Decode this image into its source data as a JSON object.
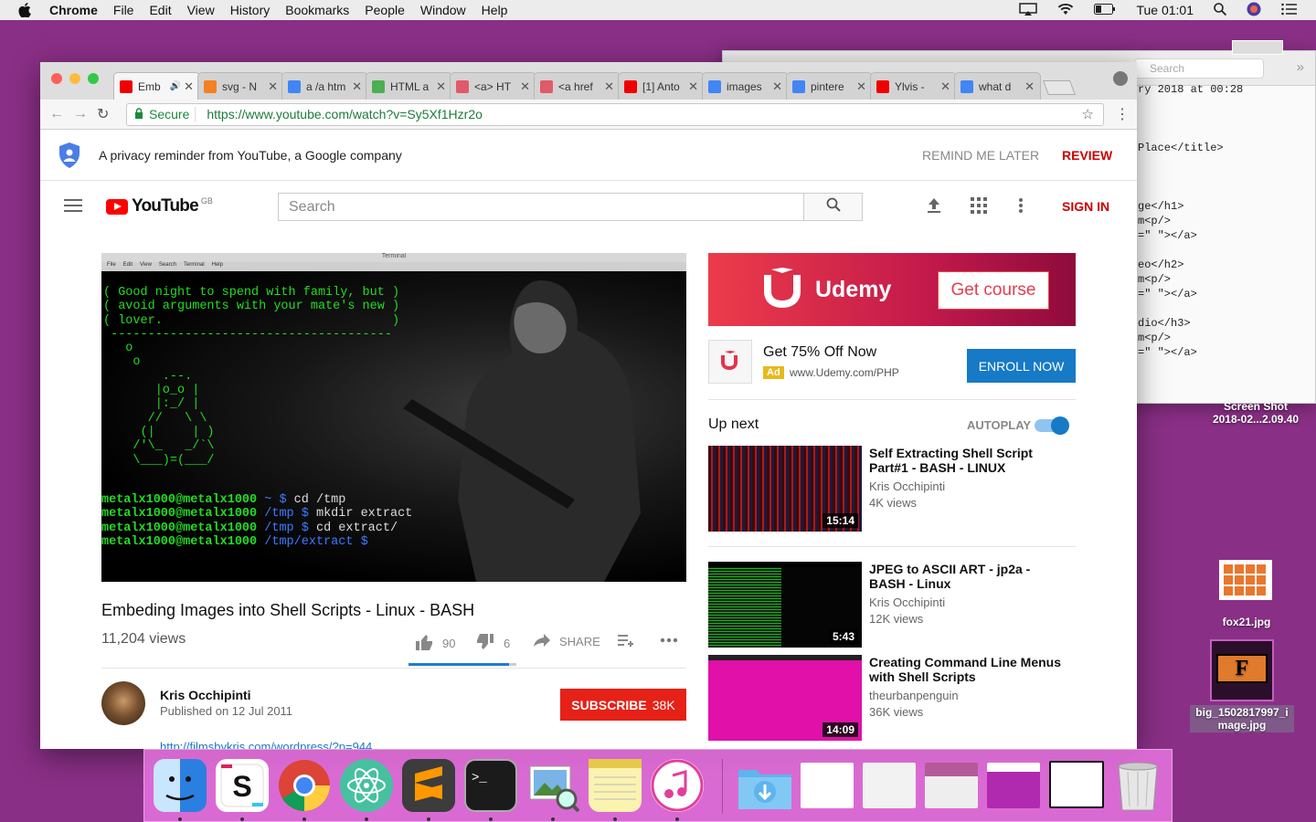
{
  "menubar": {
    "app": "Chrome",
    "items": [
      "File",
      "Edit",
      "View",
      "History",
      "Bookmarks",
      "People",
      "Window",
      "Help"
    ],
    "clock": "Tue 01:01"
  },
  "bg_window": {
    "search_placeholder": "Search",
    "lines": [
      "ry 2018 at 00:28",
      "",
      "",
      "",
      "Place</title>",
      "",
      "",
      "",
      "ge</h1>",
      "m<p/>",
      "=\" \"></a>",
      "",
      "eo</h2>",
      "m<p/>",
      "=\" \"></a>",
      "",
      "dio</h3>",
      "m<p/>",
      "=\" \"></a>"
    ]
  },
  "desktop": {
    "screenshot_label": "Screen Shot",
    "screenshot_date": "2018-02...2.09.40",
    "fox_label": "fox21.jpg",
    "big_label_1": "big_1502817997_i",
    "big_label_2": "mage.jpg"
  },
  "browser": {
    "tabs": [
      {
        "title": "Emb",
        "icon": "youtube-icon",
        "color": "#e00"
      },
      {
        "title": "svg - N",
        "icon": "stackoverflow-icon",
        "color": "#f48024"
      },
      {
        "title": "a /a htm",
        "icon": "google-icon",
        "color": "#4285f4"
      },
      {
        "title": "HTML a",
        "icon": "w3-icon",
        "color": "#4caf50"
      },
      {
        "title": "<a> HT",
        "icon": "h-icon",
        "color": "#e05a6a"
      },
      {
        "title": "<a href",
        "icon": "h-icon",
        "color": "#e05a6a"
      },
      {
        "title": "[1] Anto",
        "icon": "youtube-icon",
        "color": "#e00"
      },
      {
        "title": "images",
        "icon": "google-icon",
        "color": "#4285f4"
      },
      {
        "title": "pintere",
        "icon": "google-icon",
        "color": "#4285f4"
      },
      {
        "title": "Ylvis -",
        "icon": "youtube-icon",
        "color": "#e00"
      },
      {
        "title": "what d",
        "icon": "google-icon",
        "color": "#4285f4"
      }
    ],
    "secure": "Secure",
    "url": "https://www.youtube.com/watch?v=Sy5Xf1Hzr2o"
  },
  "privacy": {
    "text": "A privacy reminder from YouTube, a Google company",
    "remind": "REMIND ME LATER",
    "review": "REVIEW"
  },
  "youtube": {
    "logo": "YouTube",
    "region": "GB",
    "search_placeholder": "Search",
    "sign_in": "SIGN IN"
  },
  "video": {
    "term_title": "Terminal",
    "term_menu": [
      "File",
      "Edit",
      "View",
      "Search",
      "Terminal",
      "Help"
    ],
    "title": "Embeding Images into Shell Scripts - Linux - BASH",
    "views": "11,204 views",
    "likes": "90",
    "dislikes": "6",
    "share": "SHARE",
    "channel": "Kris Occhipinti",
    "published": "Published on 12 Jul 2011",
    "subscribe": "SUBSCRIBE",
    "subs": "38K",
    "link": "http://filmsbykris.com/wordpress/?p=944"
  },
  "ad": {
    "brand": "Udemy",
    "cta": "Get course",
    "headline": "Get 75% Off Now",
    "badge": "Ad",
    "url": "www.Udemy.com/PHP",
    "enroll": "ENROLL NOW"
  },
  "upnext": {
    "label": "Up next",
    "autoplay": "AUTOPLAY",
    "autoplay_on": true,
    "items": [
      {
        "title": "Self Extracting Shell Script Part#1 - BASH - LINUX",
        "channel": "Kris Occhipinti",
        "views": "4K views",
        "duration": "15:14"
      },
      {
        "title": "JPEG to ASCII ART - jp2a - BASH - Linux",
        "channel": "Kris Occhipinti",
        "views": "12K views",
        "duration": "5:43"
      },
      {
        "title": "Creating Command Line Menus with Shell Scripts",
        "channel": "theurbanpenguin",
        "views": "36K views",
        "duration": "14:09"
      }
    ]
  },
  "dock": [
    "finder-icon",
    "slack-icon",
    "chrome-icon",
    "atom-icon",
    "sublime-icon",
    "terminal-icon",
    "preview-icon",
    "notes-icon",
    "itunes-icon",
    "downloads-icon",
    "window-thumb-1",
    "window-thumb-2",
    "window-thumb-3",
    "window-thumb-4",
    "window-thumb-5",
    "trash-icon"
  ]
}
